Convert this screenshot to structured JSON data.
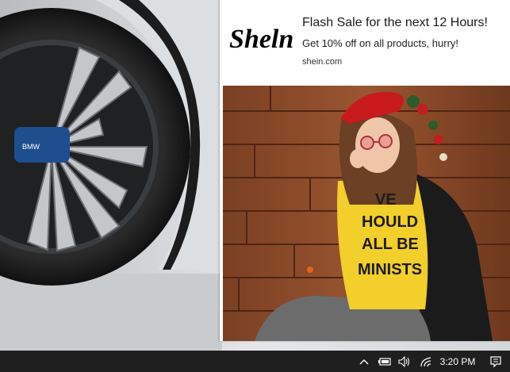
{
  "ad": {
    "brand_logo_text": "Sheln",
    "headline": "Flash Sale for the next 12 Hours!",
    "subline": "Get 10% off on all products, hurry!",
    "domain": "shein.com",
    "shirt_text": [
      "VE",
      "HOULD",
      "ALL BE",
      "MINISTS"
    ]
  },
  "desktop": {
    "wheel_badge": "BMW"
  },
  "taskbar": {
    "time": "3:20 PM",
    "icons": [
      "chevron-up-icon",
      "battery-icon",
      "volume-icon",
      "network-icon",
      "notification-icon"
    ]
  },
  "colors": {
    "taskbar_bg": "#1f1f1f",
    "ad_bg": "#ffffff",
    "wood": "#8a4a2a",
    "shirt": "#f2cf2a",
    "hat": "#c8191c"
  }
}
